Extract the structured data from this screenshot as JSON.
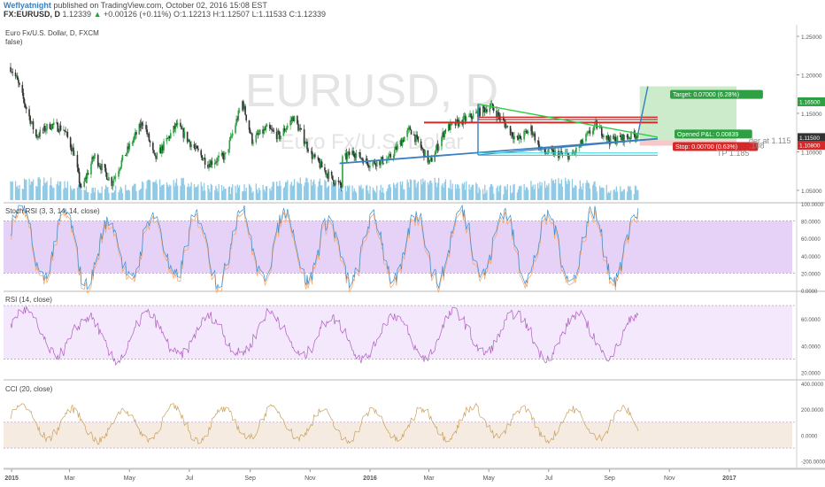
{
  "header": {
    "author": "Weflyatnight",
    "published_text": "published on TradingView.com, October 02, 2016 15:08 EST",
    "symbol": "FX:EURUSD, D",
    "last": "1.12339",
    "change_arrow": "▲",
    "change": "+0.00126 (+0.11%)",
    "open": "O:1.12213",
    "high": "H:1.12507",
    "low": "L:1.11533",
    "close": "C:1.12339"
  },
  "colors": {
    "background": "#ffffff",
    "up_candle": "#2ea043",
    "down_candle": "#333333",
    "volume": "#8ecae6",
    "resistance": "#d62828",
    "support": "#3a7ebf",
    "triangle_top": "#2ecc40",
    "target_zone": "#b9e4b9",
    "stop_zone": "#f5b5b5",
    "stoch_band": "#e0c6f5",
    "rsi_band": "#f0e2fb",
    "cci_band": "#f2e6d8"
  },
  "watermark": {
    "main": "EURUSD, D",
    "sub": "Euro Fx/U.S. Dollar"
  },
  "chart_data": [
    {
      "type": "candlestick",
      "panel": "price",
      "title": "Euro Fx/U.S. Dollar, D, FXCM",
      "subtitle": "false)",
      "x_tick_labels": [
        "2015",
        "Mar",
        "May",
        "Jul",
        "Sep",
        "Nov",
        "2016",
        "Mar",
        "May",
        "Jul",
        "Sep",
        "Nov",
        "2017"
      ],
      "y_tick_labels": [
        "1.25000",
        "1.20000",
        "1.15000",
        "1.10000",
        "1.05000"
      ],
      "ylim": [
        1.035,
        1.265
      ],
      "close_path": [
        [
          "2014-12-31",
          1.21
        ],
        [
          "2015-01-06",
          1.195
        ],
        [
          "2015-01-15",
          1.16
        ],
        [
          "2015-01-26",
          1.12
        ],
        [
          "2015-02-09",
          1.135
        ],
        [
          "2015-02-23",
          1.13
        ],
        [
          "2015-03-05",
          1.1
        ],
        [
          "2015-03-13",
          1.05
        ],
        [
          "2015-03-26",
          1.095
        ],
        [
          "2015-04-13",
          1.06
        ],
        [
          "2015-04-24",
          1.09
        ],
        [
          "2015-05-15",
          1.14
        ],
        [
          "2015-05-27",
          1.09
        ],
        [
          "2015-06-18",
          1.135
        ],
        [
          "2015-07-06",
          1.105
        ],
        [
          "2015-07-20",
          1.085
        ],
        [
          "2015-08-07",
          1.095
        ],
        [
          "2015-08-24",
          1.165
        ],
        [
          "2015-09-03",
          1.115
        ],
        [
          "2015-09-18",
          1.13
        ],
        [
          "2015-10-01",
          1.12
        ],
        [
          "2015-10-15",
          1.145
        ],
        [
          "2015-11-03",
          1.095
        ],
        [
          "2015-11-23",
          1.065
        ],
        [
          "2015-12-03",
          1.055
        ],
        [
          "2015-12-04",
          1.09
        ],
        [
          "2015-12-15",
          1.1
        ],
        [
          "2015-12-31",
          1.085
        ],
        [
          "2016-01-20",
          1.09
        ],
        [
          "2016-02-11",
          1.13
        ],
        [
          "2016-03-02",
          1.085
        ],
        [
          "2016-03-18",
          1.13
        ],
        [
          "2016-04-12",
          1.145
        ],
        [
          "2016-05-03",
          1.16
        ],
        [
          "2016-05-30",
          1.115
        ],
        [
          "2016-06-13",
          1.13
        ],
        [
          "2016-06-24",
          1.1
        ],
        [
          "2016-07-25",
          1.095
        ],
        [
          "2016-08-18",
          1.135
        ],
        [
          "2016-09-01",
          1.115
        ],
        [
          "2016-09-16",
          1.118
        ],
        [
          "2016-09-30",
          1.1234
        ]
      ],
      "volume_ylim": [
        0,
        1
      ],
      "price_labels": [
        {
          "text": "1.16500",
          "value": 1.165,
          "color": "#2ea043"
        },
        {
          "text": "1.11500",
          "value": 1.1185,
          "color": "#333333"
        },
        {
          "text": "1.10800",
          "value": 1.1085,
          "color": "#d62828"
        }
      ],
      "position": {
        "target_label": "Target: 0.07000 (6.28%)",
        "pnl_label": "Opened P&L: 0.00839",
        "stop_label": "Stop: 0.00700 (0.63%)",
        "entry": 1.115,
        "target": 1.185,
        "stop": 1.108
      },
      "annotations": {
        "order_text": "der at 1.115",
        "sl_text": ".108",
        "tp_text": "TP 1.185"
      }
    },
    {
      "type": "line",
      "panel": "stoch_rsi",
      "title": "Stoch RSI (3, 3, 14, 14, close)",
      "y_tick_labels": [
        "100.0000",
        "80.0000",
        "60.0000",
        "40.0000",
        "20.0000",
        "0.0000"
      ],
      "ylim": [
        0,
        100
      ],
      "band": [
        20,
        80
      ]
    },
    {
      "type": "line",
      "panel": "rsi",
      "title": "RSI (14, close)",
      "y_tick_labels": [
        "60.0000",
        "40.0000",
        "20.0000"
      ],
      "ylim": [
        15,
        80
      ],
      "band": [
        30,
        70
      ]
    },
    {
      "type": "line",
      "panel": "cci",
      "title": "CCI (20, close)",
      "y_tick_labels": [
        "400.0000",
        "200.0000",
        "0.0000",
        "-200.0000"
      ],
      "ylim": [
        -250,
        420
      ],
      "band": [
        -100,
        100
      ]
    }
  ]
}
